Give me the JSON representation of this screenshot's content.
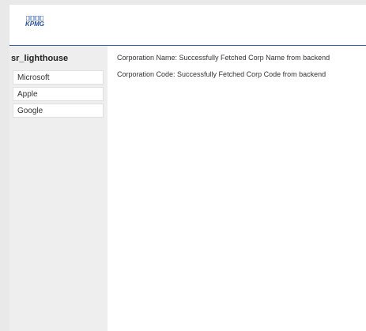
{
  "header": {
    "logo_text": "KPMG",
    "accent_color": "#2e62b0"
  },
  "sidebar": {
    "title": "sr_lighthouse",
    "items": [
      {
        "label": "Microsoft"
      },
      {
        "label": "Apple"
      },
      {
        "label": "Google"
      }
    ]
  },
  "content": {
    "corp_name": "Corporation Name: Successfully Fetched Corp Name from backend",
    "corp_code": "Corporation Code: Successfully Fetched Corp Code from backend"
  }
}
